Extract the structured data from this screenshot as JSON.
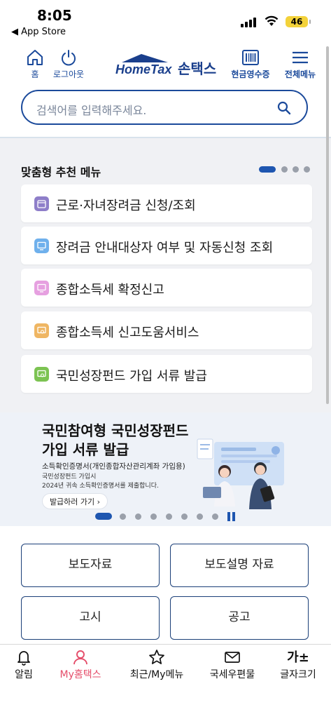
{
  "status_bar": {
    "time": "8:05",
    "back_label": "◀ App Store",
    "battery": "46"
  },
  "header": {
    "home_label": "홈",
    "logout_label": "로그아웃",
    "logo_en": "HomeTax",
    "logo_ko": "손택스",
    "receipt_label": "현금영수증",
    "menu_label": "전체메뉴"
  },
  "search": {
    "placeholder": "검색어를 입력해주세요."
  },
  "recommend": {
    "title": "맞춤형 추천 메뉴",
    "items": [
      {
        "label": "근로·자녀장려금 신청/조회",
        "color": "#8e7ec9"
      },
      {
        "label": "장려금 안내대상자 여부 및 자동신청 조회",
        "color": "#6fb0ec"
      },
      {
        "label": "종합소득세 확정신고",
        "color": "#e6a0e0"
      },
      {
        "label": "종합소득세 신고도움서비스",
        "color": "#efb663"
      },
      {
        "label": "국민성장펀드 가입 서류 발급",
        "color": "#7cc352"
      }
    ]
  },
  "banner": {
    "title_line1": "국민참여형 국민성장펀드",
    "title_line2": "가입 서류 발급",
    "sub1": "소득확인증명서(개인종합자산관리계좌 가입용)",
    "sub2": "국민성장펀드 가입시",
    "sub3": "2024년 귀속 소득확인증명서를 제출합니다.",
    "button_label": "발급하러 가기 ›"
  },
  "grid_buttons": [
    "보도자료",
    "보도설명 자료",
    "고시",
    "공고"
  ],
  "tabs": [
    {
      "label": "알림",
      "icon": "bell-icon"
    },
    {
      "label": "My홈택스",
      "icon": "person-icon",
      "active": true
    },
    {
      "label": "최근/My메뉴",
      "icon": "star-icon"
    },
    {
      "label": "국세우편물",
      "icon": "mail-icon"
    },
    {
      "label": "글자크기",
      "icon": "text-size-icon"
    }
  ],
  "tab_text_size_glyph": "가±",
  "colors": {
    "primary": "#1b4a9b",
    "accent_active": "#e54d6a"
  }
}
